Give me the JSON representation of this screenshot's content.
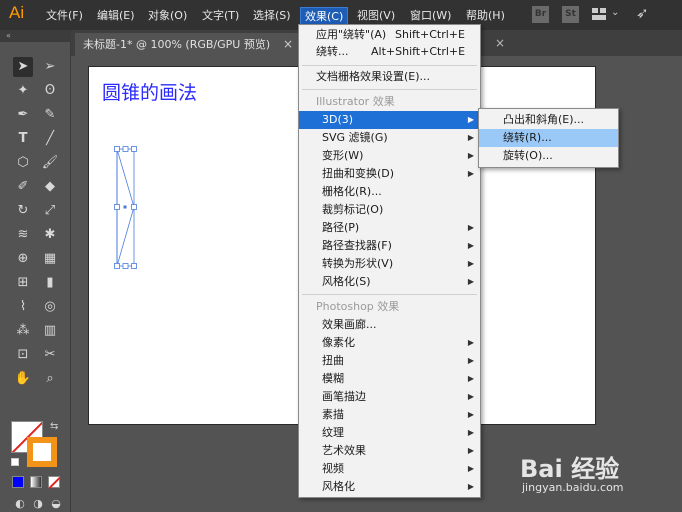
{
  "app": {
    "logo": "Ai"
  },
  "menubar": {
    "items": [
      {
        "label": "文件(F)"
      },
      {
        "label": "编辑(E)"
      },
      {
        "label": "对象(O)"
      },
      {
        "label": "文字(T)"
      },
      {
        "label": "选择(S)"
      },
      {
        "label": "效果(C)"
      },
      {
        "label": "视图(V)"
      },
      {
        "label": "窗口(W)"
      },
      {
        "label": "帮助(H)"
      }
    ],
    "right_icons": {
      "bridge": "Br",
      "stock": "St"
    }
  },
  "toolbar": {
    "collapse": "«"
  },
  "tab": {
    "title": "未标题-1* @ 100% (RGB/GPU 预览)",
    "close": "×",
    "close2": "×"
  },
  "artboard": {
    "title": "圆锥的画法"
  },
  "effect_menu": {
    "apply_last": {
      "label": "应用\"绕转\"(A)",
      "shortcut": "Shift+Ctrl+E"
    },
    "last_effect": {
      "label": "绕转...",
      "shortcut": "Alt+Shift+Ctrl+E"
    },
    "doc_raster": "文档栅格效果设置(E)...",
    "illustrator_header": "Illustrator 效果",
    "illustrator_items": [
      "3D(3)",
      "SVG 滤镜(G)",
      "变形(W)",
      "扭曲和变换(D)",
      "栅格化(R)...",
      "裁剪标记(O)",
      "路径(P)",
      "路径查找器(F)",
      "转换为形状(V)",
      "风格化(S)"
    ],
    "photoshop_header": "Photoshop 效果",
    "photoshop_items": [
      "效果画廊...",
      "像素化",
      "扭曲",
      "模糊",
      "画笔描边",
      "素描",
      "纹理",
      "艺术效果",
      "视频",
      "风格化"
    ]
  },
  "submenu_3d": {
    "items": [
      "凸出和斜角(E)...",
      "绕转(R)...",
      "旋转(O)..."
    ]
  },
  "watermark": {
    "brand": "Bai 经验",
    "url": "jingyan.baidu.com"
  },
  "colors": {
    "highlight": "#1e6fd6",
    "hover": "#9bc9f7",
    "title_blue": "#2a2aff",
    "logo_orange": "#ff9a00",
    "stroke_orange": "#f39418"
  }
}
